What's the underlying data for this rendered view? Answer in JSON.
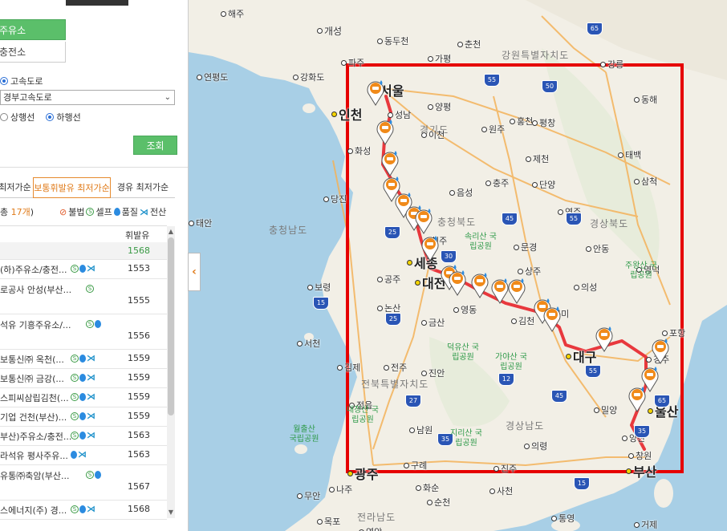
{
  "panel": {
    "tabs": [
      "주유소",
      "충전소"
    ],
    "road_type": {
      "label": "고속도로"
    },
    "road_select": {
      "value": "경부고속도로"
    },
    "direction": {
      "up": "상행선",
      "down": "하행선"
    },
    "search_button": "조회",
    "sort_tabs": [
      "최저가순",
      "보통휘발유 최저가순",
      "경유 최저가순"
    ],
    "count": {
      "prefix": "총 ",
      "num": "17개",
      "suffix": ")"
    },
    "legend": {
      "ban": "불법",
      "self": "셀프",
      "quality": "품질",
      "card": "전산"
    },
    "list_header": "휘발유",
    "rows": [
      {
        "name": "",
        "price": "1568"
      },
      {
        "name": "(하)주유소/충전...",
        "price": "1553"
      },
      {
        "name": "로공사 안성(부산...",
        "price": "1555"
      },
      {
        "name": "석유 기흥주유소/...",
        "price": "1556"
      },
      {
        "name": "보통신㈜ 옥천(...",
        "price": "1559"
      },
      {
        "name": "보통신㈜ 금강(...",
        "price": "1559"
      },
      {
        "name": "스피씨삼립김천(...",
        "price": "1559"
      },
      {
        "name": "기업 건천(부산)...",
        "price": "1559"
      },
      {
        "name": "부산)주유소/충전...",
        "price": "1563"
      },
      {
        "name": "라석유 평사주유...",
        "price": "1563"
      },
      {
        "name": "유통㈜축암(부산...",
        "price": "1567"
      },
      {
        "name": "스에너지(주) 경...",
        "price": "1568"
      }
    ]
  },
  "map": {
    "colors": {
      "route": "#e8383d",
      "box": "#e60000",
      "land": "#f2efe6",
      "sea": "#a8cfe6",
      "pin": "#f08a1a"
    },
    "cities": [
      {
        "name": "해주",
        "type": "small"
      },
      {
        "name": "개성",
        "type": "mid"
      },
      {
        "name": "동두천",
        "type": "small"
      },
      {
        "name": "춘천",
        "type": "small"
      },
      {
        "name": "파주",
        "type": "small"
      },
      {
        "name": "가평",
        "type": "small"
      },
      {
        "name": "강원특별자치도",
        "type": "region"
      },
      {
        "name": "강릉",
        "type": "small"
      },
      {
        "name": "연평도",
        "type": "small"
      },
      {
        "name": "강화도",
        "type": "small"
      },
      {
        "name": "서울",
        "type": "big"
      },
      {
        "name": "인천",
        "type": "big"
      },
      {
        "name": "성남",
        "type": "small"
      },
      {
        "name": "양평",
        "type": "small"
      },
      {
        "name": "홍천",
        "type": "small"
      },
      {
        "name": "동해",
        "type": "small"
      },
      {
        "name": "원주",
        "type": "small"
      },
      {
        "name": "경기도",
        "type": "region"
      },
      {
        "name": "이천",
        "type": "small"
      },
      {
        "name": "평창",
        "type": "small"
      },
      {
        "name": "화성",
        "type": "small"
      },
      {
        "name": "제천",
        "type": "small"
      },
      {
        "name": "태백",
        "type": "small"
      },
      {
        "name": "삼척",
        "type": "small"
      },
      {
        "name": "당진",
        "type": "small"
      },
      {
        "name": "충주",
        "type": "small"
      },
      {
        "name": "단양",
        "type": "small"
      },
      {
        "name": "음성",
        "type": "small"
      },
      {
        "name": "충청북도",
        "type": "region"
      },
      {
        "name": "영주",
        "type": "small"
      },
      {
        "name": "태안",
        "type": "small"
      },
      {
        "name": "충청남도",
        "type": "region"
      },
      {
        "name": "경상북도",
        "type": "region"
      },
      {
        "name": "청주",
        "type": "small"
      },
      {
        "name": "문경",
        "type": "small"
      },
      {
        "name": "안동",
        "type": "small"
      },
      {
        "name": "세종",
        "type": "big"
      },
      {
        "name": "공주",
        "type": "small"
      },
      {
        "name": "대전",
        "type": "big"
      },
      {
        "name": "상주",
        "type": "small"
      },
      {
        "name": "영덕",
        "type": "small"
      },
      {
        "name": "의성",
        "type": "small"
      },
      {
        "name": "보령",
        "type": "small"
      },
      {
        "name": "논산",
        "type": "small"
      },
      {
        "name": "영동",
        "type": "small"
      },
      {
        "name": "김천",
        "type": "small"
      },
      {
        "name": "구미",
        "type": "small"
      },
      {
        "name": "금산",
        "type": "small"
      },
      {
        "name": "포항",
        "type": "small"
      },
      {
        "name": "서천",
        "type": "small"
      },
      {
        "name": "대구",
        "type": "big"
      },
      {
        "name": "경주",
        "type": "small"
      },
      {
        "name": "김제",
        "type": "small"
      },
      {
        "name": "전주",
        "type": "small"
      },
      {
        "name": "진안",
        "type": "small"
      },
      {
        "name": "전북특별자치도",
        "type": "region"
      },
      {
        "name": "정읍",
        "type": "small"
      },
      {
        "name": "밀양",
        "type": "small"
      },
      {
        "name": "울산",
        "type": "big"
      },
      {
        "name": "남원",
        "type": "small"
      },
      {
        "name": "경상남도",
        "type": "region"
      },
      {
        "name": "양산",
        "type": "small"
      },
      {
        "name": "광주",
        "type": "big"
      },
      {
        "name": "창원",
        "type": "small"
      },
      {
        "name": "부산",
        "type": "big"
      },
      {
        "name": "구례",
        "type": "small"
      },
      {
        "name": "진주",
        "type": "small"
      },
      {
        "name": "의령",
        "type": "small"
      },
      {
        "name": "무안",
        "type": "small"
      },
      {
        "name": "나주",
        "type": "small"
      },
      {
        "name": "화순",
        "type": "small"
      },
      {
        "name": "사천",
        "type": "small"
      },
      {
        "name": "순천",
        "type": "small"
      },
      {
        "name": "통영",
        "type": "small"
      },
      {
        "name": "목포",
        "type": "small"
      },
      {
        "name": "전라남도",
        "type": "region"
      },
      {
        "name": "영암",
        "type": "small"
      },
      {
        "name": "거제",
        "type": "small"
      }
    ],
    "parks": [
      {
        "name": "속리산 국립공원"
      },
      {
        "name": "주왕산 국립공원"
      },
      {
        "name": "덕유산 국립공원"
      },
      {
        "name": "가야산 국립공원"
      },
      {
        "name": "내장산 국립공원"
      },
      {
        "name": "지리산 국립공원"
      },
      {
        "name": "월출산"
      },
      {
        "name": "국립공원"
      }
    ],
    "highways": [
      "65",
      "55",
      "50",
      "45",
      "55",
      "25",
      "30",
      "15",
      "15",
      "25",
      "27",
      "12",
      "45",
      "55",
      "35",
      "65",
      "35"
    ]
  }
}
